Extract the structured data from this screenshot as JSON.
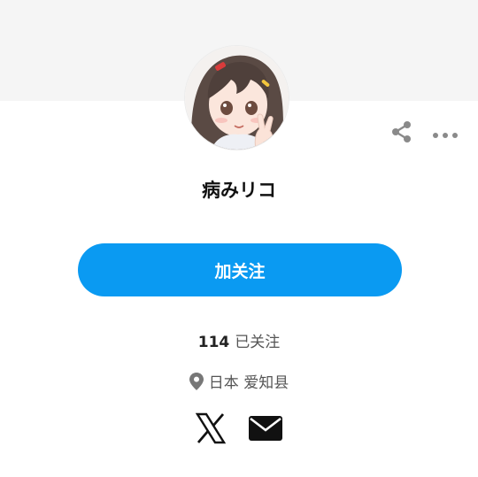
{
  "profile": {
    "name": "病みリコ",
    "follow_label": "加关注",
    "following_count": "114",
    "following_label": "已关注",
    "location": "日本 爱知县"
  },
  "icons": {
    "share": "share-icon",
    "more": "more-icon",
    "location": "location-pin-icon",
    "x": "x-logo-icon",
    "mail": "mail-icon"
  },
  "colors": {
    "accent": "#0a9af2",
    "cover": "#f5f5f5",
    "icon_gray": "#8a8a8a"
  }
}
